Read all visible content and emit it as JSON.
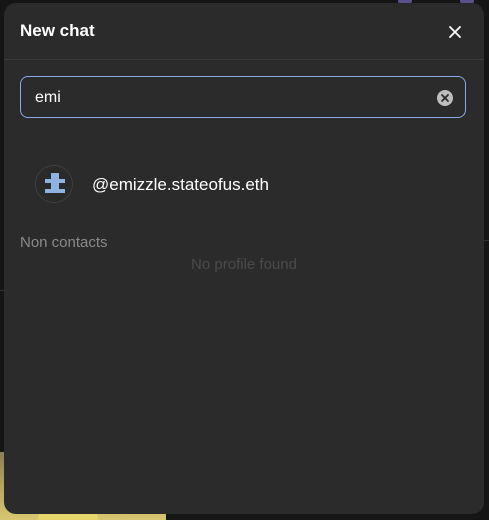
{
  "dialog": {
    "title": "New chat",
    "close_icon": "close-icon"
  },
  "search": {
    "value": "emi",
    "clear_icon": "clear-circle-icon"
  },
  "results": [
    {
      "handle": "@emizzle.stateofus.eth",
      "avatar_icon": "pixel-avatar-icon",
      "avatar_color": "#8fb3e0"
    }
  ],
  "non_contacts": {
    "label": "Non contacts",
    "empty_message": "No profile found"
  },
  "colors": {
    "modal_bg": "#2b2b2b",
    "focus_border": "#8ea7e6",
    "muted_text": "#8a8a8a"
  }
}
